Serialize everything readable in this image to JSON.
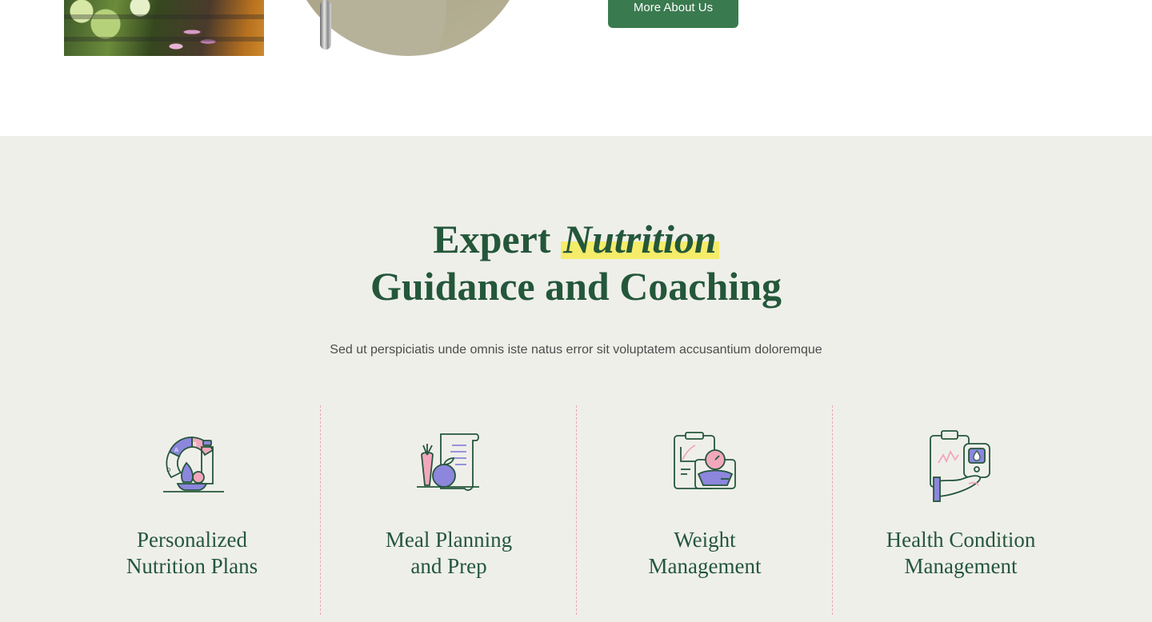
{
  "about": {
    "button_label": "More About Us"
  },
  "services": {
    "heading_part1": "Expert",
    "heading_highlight": "Nutrition",
    "heading_line2": "Guidance and Coaching",
    "subtitle": "Sed ut perspiciatis unde omnis iste natus error sit voluptatem accusantium doloremque",
    "cards": [
      {
        "title_line1": "Personalized",
        "title_line2": "Nutrition Plans",
        "icon": "nutrition-plan-icon"
      },
      {
        "title_line1": "Meal Planning",
        "title_line2": "and Prep",
        "icon": "meal-planning-icon"
      },
      {
        "title_line1": "Weight",
        "title_line2": "Management",
        "icon": "weight-scale-icon"
      },
      {
        "title_line1": "Health Condition",
        "title_line2": "Management",
        "icon": "health-monitor-icon"
      }
    ]
  },
  "colors": {
    "brand_green": "#24573a",
    "button_green": "#3a7a4f",
    "highlight_yellow": "#f5ec6a",
    "section_bg": "#efefea",
    "divider_pink": "#e5a5b3",
    "icon_purple": "#8c86dd",
    "icon_pink": "#f2a7bd"
  }
}
